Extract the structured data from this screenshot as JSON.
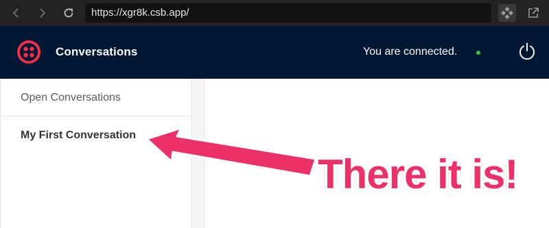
{
  "browser": {
    "url": "https://xgr8k.csb.app/",
    "back_icon": "chevron-left-icon",
    "forward_icon": "chevron-right-icon",
    "reload_icon": "reload-icon",
    "extension_icon": "codesandbox-icon",
    "open_external_icon": "open-external-icon"
  },
  "header": {
    "title": "Conversations",
    "logo_icon": "twilio-logo-icon",
    "status_text": "You are connected.",
    "status_color": "#3bc73b",
    "power_icon": "power-icon"
  },
  "sidebar": {
    "header": "Open Conversations",
    "items": [
      {
        "label": "My First Conversation"
      }
    ]
  },
  "annotation": {
    "text": "There it is!",
    "color": "#ec3068"
  },
  "colors": {
    "header_bg": "#001833",
    "logo_red": "#f22f46",
    "browser_bg": "#232323"
  }
}
